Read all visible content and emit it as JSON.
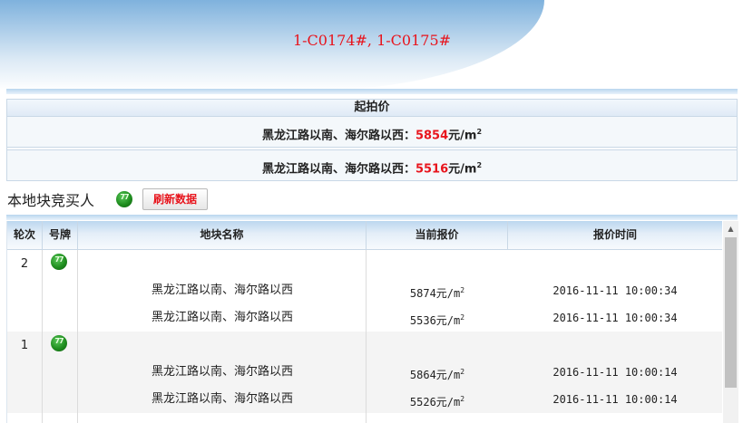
{
  "header": {
    "lot_codes": "1-C0174#, 1-C0175#"
  },
  "start_price": {
    "heading": "起拍价",
    "rows": [
      {
        "location": "黑龙江路以南、海尔路以西：",
        "price": "5854",
        "unit": "元/m",
        "unit_sup": "2"
      },
      {
        "location": "黑龙江路以南、海尔路以西：",
        "price": "5516",
        "unit": "元/m",
        "unit_sup": "2"
      }
    ]
  },
  "bidders": {
    "title": "本地块竞买人",
    "refresh_label": "刷新数据"
  },
  "table": {
    "columns": [
      "轮次",
      "号牌",
      "地块名称",
      "当前报价",
      "报价时间"
    ],
    "groups": [
      {
        "round": "2",
        "lines": [
          {
            "name": "黑龙江路以南、海尔路以西",
            "price": "5874元/m",
            "price_sup": "2",
            "time": "2016-11-11 10:00:34"
          },
          {
            "name": "黑龙江路以南、海尔路以西",
            "price": "5536元/m",
            "price_sup": "2",
            "time": "2016-11-11 10:00:34"
          }
        ]
      },
      {
        "round": "1",
        "lines": [
          {
            "name": "黑龙江路以南、海尔路以西",
            "price": "5864元/m",
            "price_sup": "2",
            "time": "2016-11-11 10:00:14"
          },
          {
            "name": "黑龙江路以南、海尔路以西",
            "price": "5526元/m",
            "price_sup": "2",
            "time": "2016-11-11 10:00:14"
          }
        ]
      }
    ]
  },
  "icons": {
    "bidder_badge": "green-round-badge-icon",
    "scroll_up": "arrow-up-icon"
  },
  "colors": {
    "accent_red": "#e8141c",
    "header_blue": "#bcd7ef",
    "badge_green": "#1f8e1f"
  }
}
